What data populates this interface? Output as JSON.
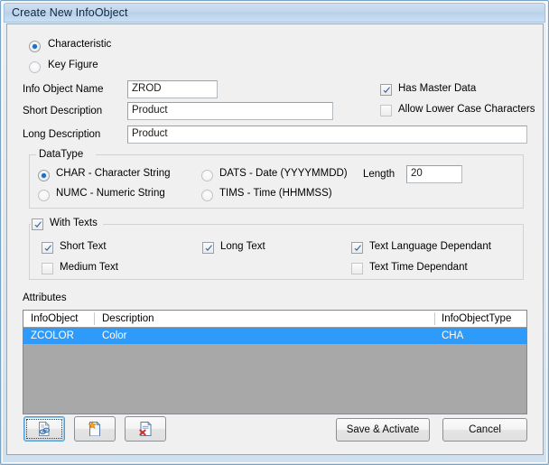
{
  "window": {
    "title": "Create New InfoObject"
  },
  "object_type": {
    "options": [
      {
        "label": "Characteristic",
        "selected": true
      },
      {
        "label": "Key Figure",
        "selected": false
      }
    ]
  },
  "fields": {
    "info_object_name": {
      "label": "Info Object Name",
      "value": "ZROD"
    },
    "short_description": {
      "label": "Short Description",
      "value": "Product"
    },
    "long_description": {
      "label": "Long Description",
      "value": "Product"
    }
  },
  "flags": {
    "has_master_data": {
      "label": "Has Master Data",
      "checked": true
    },
    "allow_lower_case": {
      "label": "Allow Lower Case Characters",
      "checked": false
    }
  },
  "data_type": {
    "group_label": "DataType",
    "options": [
      {
        "label": "CHAR - Character String",
        "selected": true
      },
      {
        "label": "NUMC - Numeric String",
        "selected": false
      },
      {
        "label": "DATS - Date (YYYYMMDD)",
        "selected": false
      },
      {
        "label": "TIMS - Time (HHMMSS)",
        "selected": false
      }
    ],
    "length": {
      "label": "Length",
      "value": "20"
    }
  },
  "with_texts": {
    "group_label": "With Texts",
    "group_checked": true,
    "options": [
      {
        "label": "Short Text",
        "checked": true
      },
      {
        "label": "Medium Text",
        "checked": false
      },
      {
        "label": "Long Text",
        "checked": true
      },
      {
        "label": "Text Language Dependant",
        "checked": true
      },
      {
        "label": "Text Time Dependant",
        "checked": false
      }
    ]
  },
  "attributes": {
    "section_label": "Attributes",
    "columns": [
      "InfoObject",
      "Description",
      "InfoObjectType"
    ],
    "rows": [
      {
        "info_object": "ZCOLOR",
        "description": "Color",
        "info_object_type": "CHA",
        "selected": true
      }
    ]
  },
  "toolbar": {
    "buttons": [
      {
        "icon": "document-search-icon",
        "focused": true
      },
      {
        "icon": "document-new-icon",
        "focused": false
      },
      {
        "icon": "document-delete-icon",
        "focused": false
      }
    ]
  },
  "actions": {
    "save": "Save & Activate",
    "cancel": "Cancel"
  },
  "colors": {
    "title_text": "#0c2a43",
    "selection": "#2e9bfb",
    "table_empty": "#a8a8a8",
    "client_bg": "#f0f0f0"
  }
}
